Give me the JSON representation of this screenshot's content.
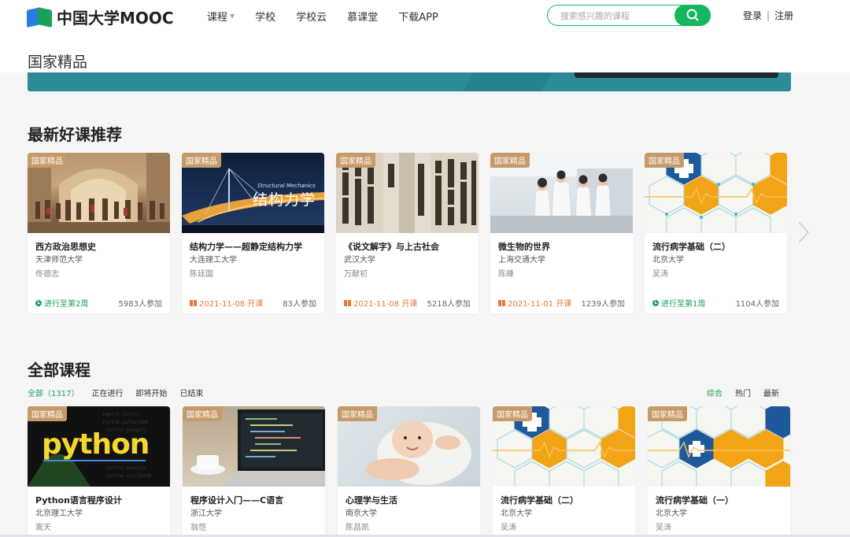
{
  "header": {
    "logo_text": "中国大学MOOC",
    "nav": [
      "课程",
      "学校",
      "学校云",
      "慕课堂",
      "下载APP"
    ],
    "search_placeholder": "搜索感兴趣的课程",
    "login": "登录",
    "separator": "|",
    "register": "注册"
  },
  "page_title": "国家精品",
  "sections": {
    "recommend_title": "最新好课推荐",
    "all_title": "全部课程"
  },
  "recommend_courses": [
    {
      "tag": "国家精品",
      "name": "西方政治思想史",
      "school": "天津师范大学",
      "teacher": "佟德志",
      "status": "进行至第2周",
      "status_type": "ongoing",
      "count": "5983人参加"
    },
    {
      "tag": "国家精品",
      "name": "结构力学——超静定结构力学",
      "school": "大连理工大学",
      "teacher": "陈廷国",
      "status": "2021-11-08 开课",
      "status_type": "upcoming",
      "count": "83人参加",
      "thumb_text": "结构力学",
      "thumb_subtext": "Structural Mechanics"
    },
    {
      "tag": "国家精品",
      "name": "《说文解字》与上古社会",
      "school": "武汉大学",
      "teacher": "万献初",
      "status": "2021-11-08 开课",
      "status_type": "upcoming",
      "count": "5218人参加"
    },
    {
      "tag": "国家精品",
      "name": "微生物的世界",
      "school": "上海交通大学",
      "teacher": "陈峰",
      "status": "2021-11-01 开课",
      "status_type": "upcoming",
      "count": "1239人参加"
    },
    {
      "tag": "国家精品",
      "name": "流行病学基础（二）",
      "school": "北京大学",
      "teacher": "吴涛",
      "status": "进行至第1周",
      "status_type": "ongoing",
      "count": "1104人参加"
    }
  ],
  "filters": [
    "全部（1317）",
    "正在进行",
    "即将开始",
    "已结束"
  ],
  "sorts": [
    "综合",
    "热门",
    "最新"
  ],
  "all_courses": [
    {
      "tag": "国家精品",
      "name": "Python语言程序设计",
      "school": "北京理工大学",
      "teacher": "嵩天",
      "thumb_text": "python"
    },
    {
      "tag": "国家精品",
      "name": "程序设计入门——C语言",
      "school": "浙江大学",
      "teacher": "翁恺"
    },
    {
      "tag": "国家精品",
      "name": "心理学与生活",
      "school": "南京大学",
      "teacher": "陈昌凯"
    },
    {
      "tag": "国家精品",
      "name": "流行病学基础（二）",
      "school": "北京大学",
      "teacher": "吴涛"
    },
    {
      "tag": "国家精品",
      "name": "流行病学基础（一）",
      "school": "北京大学",
      "teacher": "吴涛"
    }
  ],
  "colors": {
    "accent": "#14b85c",
    "tag": "#c79a6a",
    "upcoming": "#e8783a"
  }
}
